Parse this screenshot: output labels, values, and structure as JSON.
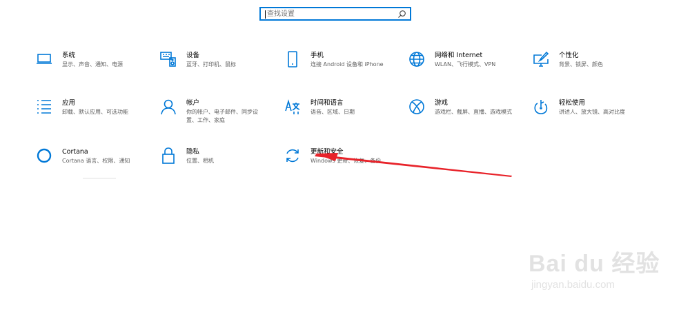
{
  "search": {
    "placeholder": "查找设置"
  },
  "tiles": [
    {
      "title": "系统",
      "desc": "显示、声音、通知、电源",
      "icon": "laptop-icon"
    },
    {
      "title": "设备",
      "desc": "蓝牙、打印机、鼠标",
      "icon": "keyboard-speaker-icon"
    },
    {
      "title": "手机",
      "desc": "连接 Android 设备和 iPhone",
      "icon": "phone-icon"
    },
    {
      "title": "网络和 Internet",
      "desc": "WLAN、飞行模式、VPN",
      "icon": "globe-icon"
    },
    {
      "title": "个性化",
      "desc": "背景、锁屏、颜色",
      "icon": "paint-monitor-icon"
    },
    {
      "title": "应用",
      "desc": "卸载、默认应用、可选功能",
      "icon": "apps-list-icon"
    },
    {
      "title": "帐户",
      "desc": "你的帐户、电子邮件、同步设置、工作、家庭",
      "icon": "person-icon"
    },
    {
      "title": "时间和语言",
      "desc": "语音、区域、日期",
      "icon": "time-language-icon"
    },
    {
      "title": "游戏",
      "desc": "游戏栏、截屏、直播、游戏模式",
      "icon": "xbox-icon"
    },
    {
      "title": "轻松使用",
      "desc": "讲述人、放大镜、高对比度",
      "icon": "ease-of-access-icon"
    },
    {
      "title": "Cortana",
      "desc": "Cortana 语言、权限、通知",
      "icon": "cortana-circle-icon"
    },
    {
      "title": "隐私",
      "desc": "位置、相机",
      "icon": "lock-icon"
    },
    {
      "title": "更新和安全",
      "desc": "Windows 更新、恢复、备份",
      "icon": "sync-arrows-icon"
    }
  ],
  "watermark": {
    "brand": "Bai du 经验",
    "url": "jingyan.baidu.com"
  },
  "colors": {
    "accent": "#0078d7",
    "annotation": "#e8232a"
  }
}
